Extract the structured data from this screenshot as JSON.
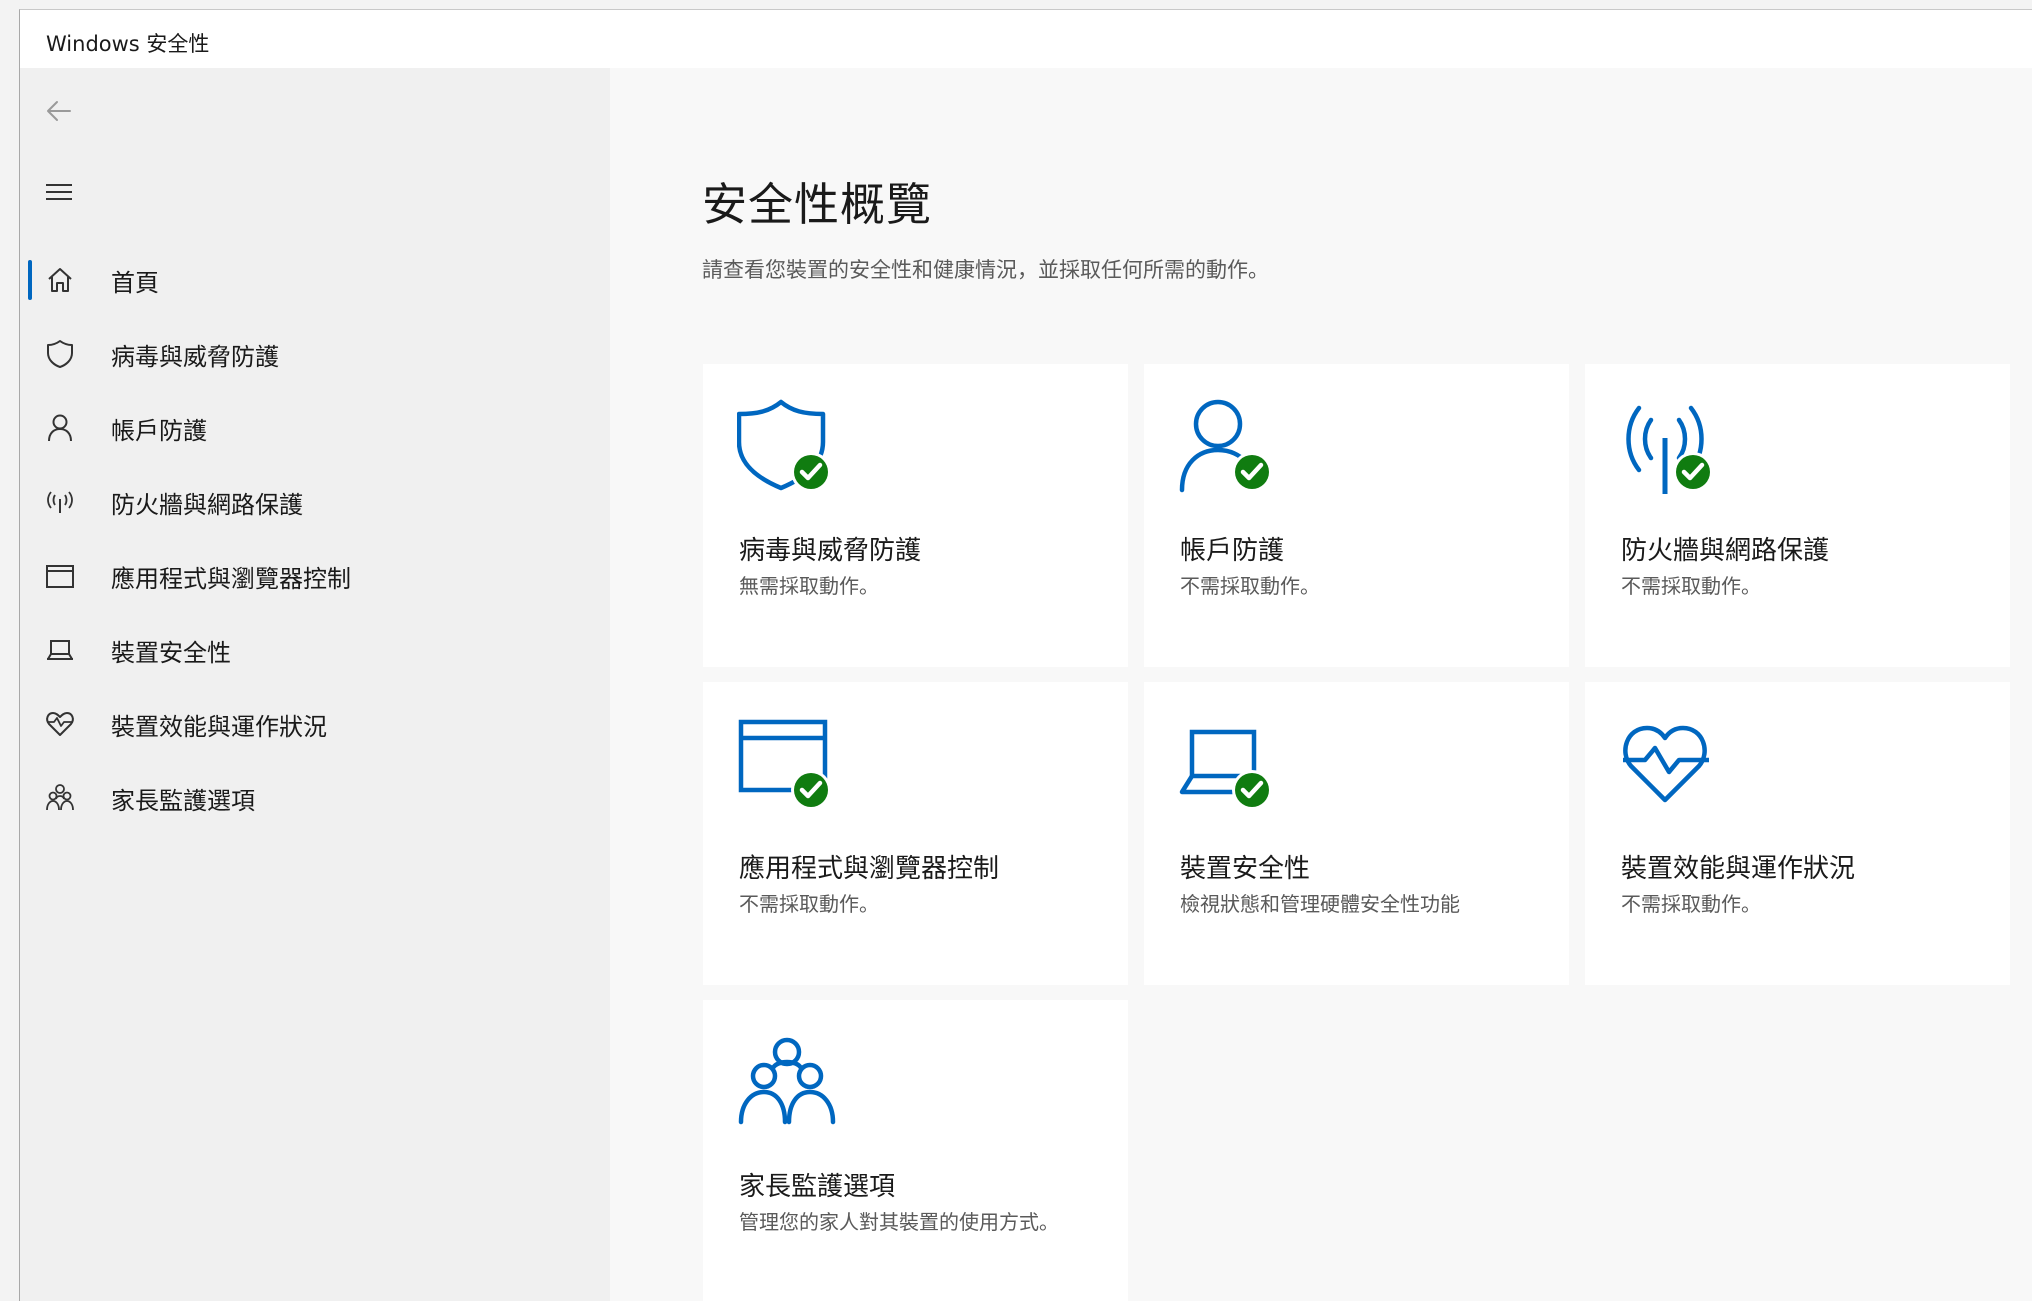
{
  "window": {
    "title": "Windows 安全性"
  },
  "sidebar": {
    "items": [
      {
        "label": "首頁",
        "icon": "home-icon",
        "active": true
      },
      {
        "label": "病毒與威脅防護",
        "icon": "shield-icon"
      },
      {
        "label": "帳戶防護",
        "icon": "person-icon"
      },
      {
        "label": "防火牆與網路保護",
        "icon": "wireless-icon"
      },
      {
        "label": "應用程式與瀏覽器控制",
        "icon": "app-window-icon"
      },
      {
        "label": "裝置安全性",
        "icon": "laptop-icon"
      },
      {
        "label": "裝置效能與運作狀況",
        "icon": "heart-pulse-icon"
      },
      {
        "label": "家長監護選項",
        "icon": "family-icon"
      }
    ]
  },
  "main": {
    "title": "安全性概覽",
    "subtitle": "請查看您裝置的安全性和健康情況，並採取任何所需的動作。",
    "cards": [
      {
        "title": "病毒與威脅防護",
        "status": "無需採取動作。",
        "icon": "shield-icon",
        "ok": true
      },
      {
        "title": "帳戶防護",
        "status": "不需採取動作。",
        "icon": "person-icon",
        "ok": true
      },
      {
        "title": "防火牆與網路保護",
        "status": "不需採取動作。",
        "icon": "wireless-icon",
        "ok": true
      },
      {
        "title": "應用程式與瀏覽器控制",
        "status": "不需採取動作。",
        "icon": "app-window-icon",
        "ok": true
      },
      {
        "title": "裝置安全性",
        "status": "檢視狀態和管理硬體安全性功能",
        "icon": "laptop-icon",
        "ok": true
      },
      {
        "title": "裝置效能與運作狀況",
        "status": "不需採取動作。",
        "icon": "heart-pulse-icon",
        "ok": false
      },
      {
        "title": "家長監護選項",
        "status": "管理您的家人對其裝置的使用方式。",
        "icon": "family-icon",
        "ok": false
      }
    ]
  },
  "colors": {
    "accent": "#0067c0",
    "ok_badge": "#107c10"
  }
}
